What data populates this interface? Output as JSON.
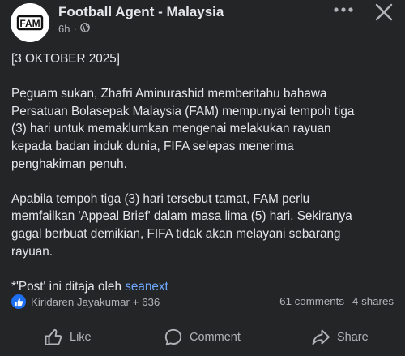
{
  "header": {
    "page_name": "Football Agent - Malaysia",
    "time": "6h",
    "separator": "·",
    "logo_text": "FAM"
  },
  "post": {
    "paragraphs": [
      "[3 OKTOBER 2025]",
      "Peguam sukan, Zhafri Aminurashid memberitahu bahawa\nPersatuan Bolasepak Malaysia (FAM) mempunyai tempoh tiga\n(3) hari untuk memaklumkan mengenai melakukan rayuan\nkepada badan induk dunia, FIFA selepas menerima\npenghakiman penuh.",
      "Apabila tempoh tiga (3) hari tersebut tamat, FAM perlu\nmemfailkan 'Appeal Brief' dalam masa lima (5) hari. Sekiranya\ngagal berbuat demikian, FIFA tidak akan melayani sebarang\nrayuan."
    ],
    "sponsor_prefix": "*'Post' ini ditaja oleh ",
    "sponsor_link": "seanext"
  },
  "reactions": {
    "names": "Kiridaren Jayakumar + 636",
    "comments": "61 comments",
    "shares": "4 shares"
  },
  "actions": {
    "like": "Like",
    "comment": "Comment",
    "share": "Share"
  },
  "colors": {
    "background": "#242526",
    "text": "#e4e6eb",
    "secondary": "#b0b3b8",
    "link": "#6ea8ff",
    "like_blue": "#1d6ff2"
  },
  "icons": {
    "globe": "globe-icon",
    "more": "more-horizontal-icon",
    "close": "close-icon",
    "like_reaction": "thumbs-up-icon",
    "like_action": "like-outline-icon",
    "comment_action": "comment-bubble-icon",
    "share_action": "share-arrow-icon"
  }
}
